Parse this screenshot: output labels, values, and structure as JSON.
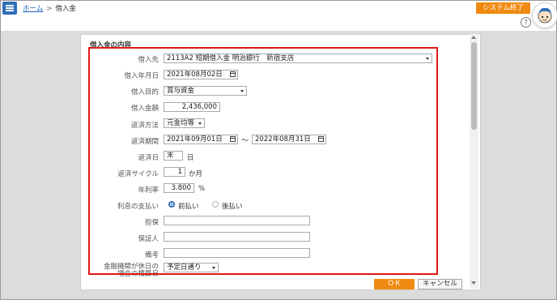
{
  "header": {
    "breadcrumb_home": "ホーム",
    "breadcrumb_sep": ">",
    "breadcrumb_current": "借入金",
    "exit_button": "システム終了",
    "help": "?"
  },
  "form": {
    "section_title": "借入金の内容",
    "lender": {
      "label": "借入先",
      "value": "2113A2 短期借入金 明治銀行　新宿支店"
    },
    "borrow_date": {
      "label": "借入年月日",
      "value": "2021年08月02日"
    },
    "purpose": {
      "label": "借入目的",
      "value": "賞与資金"
    },
    "amount": {
      "label": "借入金額",
      "value": "2,436,000"
    },
    "repay_method": {
      "label": "返済方法",
      "value": "元金均等"
    },
    "repay_period": {
      "label": "返済期間",
      "from": "2021年09月01日",
      "tilde": "～",
      "to": "2022年08月31日"
    },
    "repay_day": {
      "label": "返済日",
      "value": "末",
      "unit": "日"
    },
    "repay_cycle": {
      "label": "返済サイクル",
      "value": "1",
      "unit": "か月"
    },
    "annual_rate": {
      "label": "年利率",
      "value": "3.800",
      "unit": "%"
    },
    "interest_payment": {
      "label": "利息の支払い",
      "options": [
        "前払い",
        "後払い"
      ],
      "selected": "前払い"
    },
    "collateral": {
      "label": "担保",
      "value": ""
    },
    "guarantor": {
      "label": "保証人",
      "value": ""
    },
    "remarks": {
      "label": "備考",
      "value": ""
    },
    "holiday_handling": {
      "label_line1": "金融機関が休日の",
      "label_line2": "場合の精算日",
      "value": "予定日通り"
    }
  },
  "footer": {
    "ok_button": "ＯＫ",
    "cancel_button": "キャンセル"
  },
  "colors": {
    "accent_orange": "#f08a10",
    "menu_blue": "#2f6fb8",
    "highlight_red": "#e01818"
  },
  "icons": [
    "menu-icon",
    "help-icon",
    "avatar",
    "calendar-icon",
    "dropdown-caret-icon"
  ]
}
